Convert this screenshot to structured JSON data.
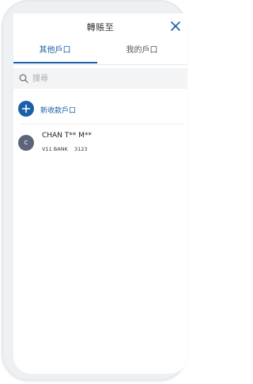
{
  "header": {
    "title": "轉賬至",
    "close_icon": "close-icon"
  },
  "tabs": [
    {
      "label": "其他戶口",
      "active": true
    },
    {
      "label": "我的戶口",
      "active": false
    }
  ],
  "search": {
    "placeholder": "搜尋",
    "value": "",
    "icon": "search-icon"
  },
  "add_account": {
    "label": "新收款戶口",
    "icon": "plus-icon"
  },
  "accounts": [
    {
      "initial": "C",
      "name": "CHAN T** M**",
      "bank": "V11 BANK",
      "number": "3123"
    }
  ],
  "colors": {
    "accent": "#1a5fa8",
    "avatar": "#5c6478",
    "search_bg": "#f3f4f6"
  }
}
